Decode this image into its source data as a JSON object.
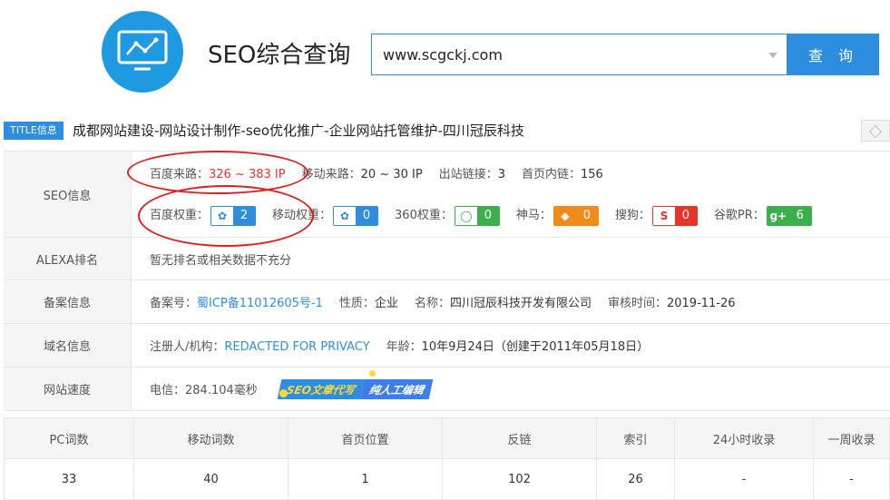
{
  "header": {
    "app_title": "SEO综合查询",
    "search_value": "www.scgckj.com",
    "search_button": "查 询"
  },
  "title_row": {
    "badge": "TITLE信息",
    "text": "成都网站建设-网站设计制作-seo优化推广-企业网站托管维护-四川冠辰科技"
  },
  "seo": {
    "label": "SEO信息",
    "baidu_traffic_label": "百度来路：",
    "baidu_traffic_value": "326 ~ 383 IP",
    "mobile_traffic_label": "移动来路：",
    "mobile_traffic_value": "20 ~ 30 IP",
    "outlinks_label": "出站链接：",
    "outlinks_value": "3",
    "home_inlinks_label": "首页内链：",
    "home_inlinks_value": "156",
    "weights": [
      {
        "label": "百度权重：",
        "icon": "paw-icon",
        "value": "2",
        "color": "#2d8ee0"
      },
      {
        "label": "移动权重：",
        "icon": "paw-icon",
        "value": "0",
        "color": "#2d8ee0"
      },
      {
        "label": "360权重：",
        "icon": "360-icon",
        "value": "0",
        "color": "#3bb04a"
      },
      {
        "label": "神马：",
        "icon": "shenma-icon",
        "value": "0",
        "color": "#f08a1d"
      },
      {
        "label": "搜狗：",
        "icon": "sogou-icon",
        "value": "0",
        "color": "#e8332a"
      },
      {
        "label": "谷歌PR：",
        "icon": "google-plus-icon",
        "value": "6",
        "color": "#3bb04a"
      }
    ]
  },
  "alexa": {
    "label": "ALEXA排名",
    "text": "暂无排名或相关数据不充分"
  },
  "icp": {
    "label": "备案信息",
    "number_label": "备案号：",
    "number": "蜀ICP备11012605号-1",
    "nature_label": "性质：",
    "nature": "企业",
    "name_label": "名称：",
    "name": "四川冠辰科技开发有限公司",
    "review_label": "审核时间：",
    "review": "2019-11-26"
  },
  "domain": {
    "label": "域名信息",
    "registrant_label": "注册人/机构：",
    "registrant": "REDACTED FOR PRIVACY",
    "age_label": "年龄：",
    "age": "10年9月24日（创建于2011年05月18日）"
  },
  "speed": {
    "label": "网站速度",
    "value": "电信：284.104毫秒",
    "promo_a": "SEO文章代写",
    "promo_b": "纯人工编辑"
  },
  "stats": {
    "headers": [
      "PC词数",
      "移动词数",
      "首页位置",
      "反链",
      "索引",
      "24小时收录",
      "一周收录"
    ],
    "values": [
      "33",
      "40",
      "1",
      "102",
      "26",
      "-",
      "-"
    ]
  }
}
